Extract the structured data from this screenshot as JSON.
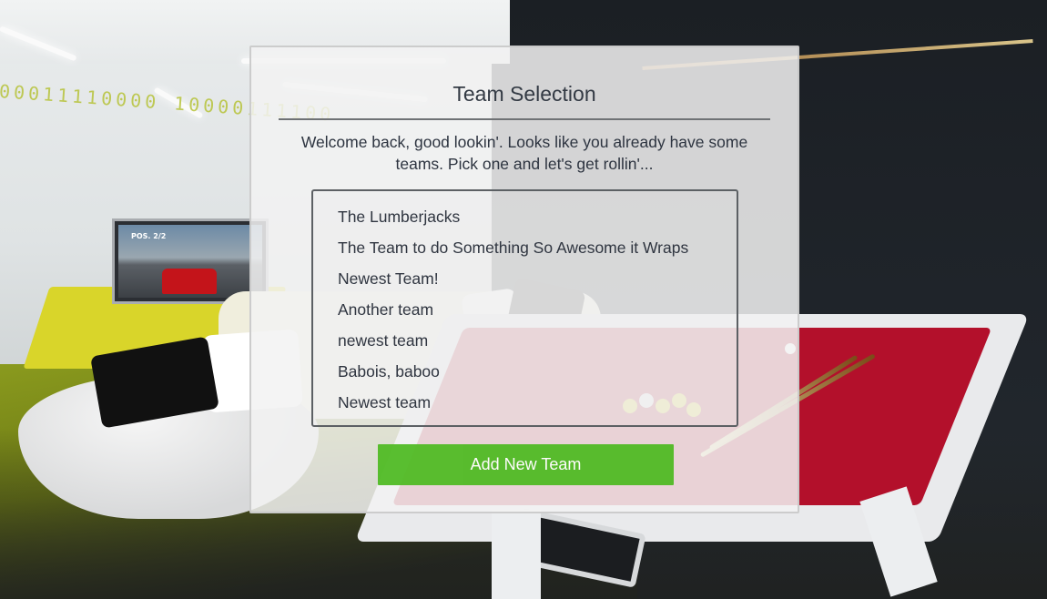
{
  "background": {
    "tv_overlay": "POS. 2/2",
    "wall_text": "00011110000 10000111100"
  },
  "dialog": {
    "title": "Team Selection",
    "subtitle": "Welcome back, good lookin'. Looks like you already have some teams. Pick one and let's get rollin'...",
    "teams": [
      "The Lumberjacks",
      "The Team to do Something So Awesome it Wraps",
      "Newest Team!",
      "Another team",
      "newest team",
      "Babois, baboo",
      "Newest team"
    ],
    "add_button_label": "Add New Team"
  },
  "colors": {
    "accent_green": "#4cba1f",
    "dialog_bg": "#f2f2f2",
    "text": "#2f3540"
  }
}
